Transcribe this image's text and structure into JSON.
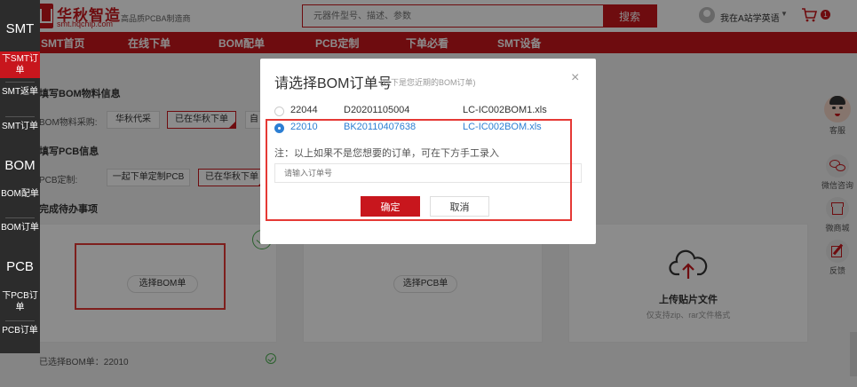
{
  "header": {
    "logo_name": "华秋智造",
    "logo_domain": "smt.hqchip.com",
    "slogan": "高品质PCBA制造商",
    "search_placeholder": "元器件型号、描述、参数",
    "search_button": "搜索",
    "user_name": "我在A站学英语",
    "cart_count": "1"
  },
  "nav": {
    "items": [
      "SMT首页",
      "在线下单",
      "BOM配单",
      "PCB定制",
      "下单必看",
      "SMT设备"
    ]
  },
  "left_sidebar": {
    "items": [
      {
        "label": "SMT"
      },
      {
        "label": "下SMT订单"
      },
      {
        "label": "SMT返单"
      },
      {
        "label": "SMT订单"
      },
      {
        "label": "BOM"
      },
      {
        "label": "BOM配单"
      },
      {
        "label": "BOM订单"
      },
      {
        "label": "PCB"
      },
      {
        "label": "下PCB订单"
      },
      {
        "label": "PCB订单"
      }
    ]
  },
  "main": {
    "bom_section_title": "填写BOM物料信息",
    "bom_purchase_label": "BOM物料采购:",
    "bom_opt1": "华秋代采",
    "bom_opt2": "已在华秋下单",
    "bom_opt3": "自",
    "pcb_section_title": "填写PCB信息",
    "pcb_label": "PCB定制:",
    "pcb_opt1": "一起下单定制PCB",
    "pcb_opt2": "已在华秋下单",
    "todo_section_title": "完成待办事项",
    "card1_button": "选择BOM单",
    "card2_button": "选择PCB单",
    "card3_title": "上传贴片文件",
    "card3_sub": "仅支持zip、rar文件格式",
    "selected_bom": "已选择BOM单：22010"
  },
  "right_sidebar": {
    "items": [
      "客服",
      "微信咨询",
      "微商城",
      "反馈"
    ]
  },
  "modal": {
    "title": "请选择BOM订单号",
    "subtitle": "(以下是您近期的BOM订单)",
    "close": "×",
    "rows": [
      {
        "id": "22044",
        "order": "D20201105004",
        "file": "LC-IC002BOM1.xls"
      },
      {
        "id": "22010",
        "order": "BK20110407638",
        "file": "LC-IC002BOM.xls"
      }
    ],
    "note": "注：以上如果不是您想要的订单，可在下方手工录入",
    "input_placeholder": "请输入订单号",
    "confirm": "确定",
    "cancel": "取消"
  },
  "colors": {
    "brand_red": "#c8161d",
    "selection_blue": "#2d7fd3",
    "highlight_red": "#e53935"
  }
}
